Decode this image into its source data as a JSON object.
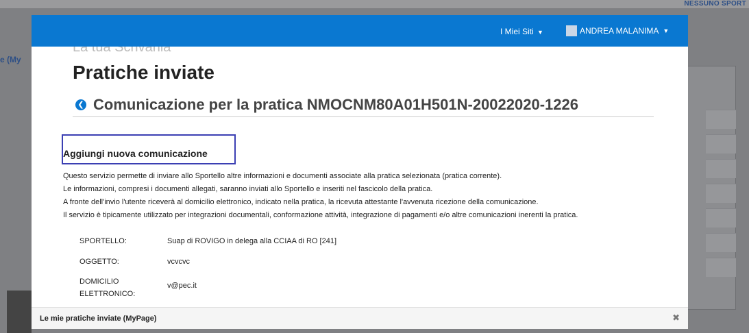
{
  "background": {
    "top_right_text": "NESSUNO SPORT",
    "left_text": "e (My"
  },
  "topbar": {
    "sites_label": "I Miei Siti",
    "user_name": "ANDREA MALANIMA"
  },
  "page": {
    "ghost_title": "La tua Scrivania",
    "title": "Pratiche inviate",
    "subtitle": "Comunicazione per la pratica NMOCNM80A01H501N-20022020-1226"
  },
  "section": {
    "title": "Aggiungi nuova comunicazione",
    "description": [
      "Questo servizio permette di inviare allo Sportello altre informazioni e documenti associate alla pratica selezionata (pratica corrente).",
      "Le informazioni, compresi i documenti allegati, saranno inviati allo Sportello e inseriti nel fascicolo della pratica.",
      "A fronte dell'invio l'utente riceverà al domicilio elettronico, indicato nella pratica, la ricevuta attestante l'avvenuta ricezione della comunicazione.",
      "Il servizio è tipicamente utilizzato per integrazioni documentali, conformazione attività, integrazione di pagamenti e/o altre comunicazioni inerenti la pratica."
    ]
  },
  "info": [
    {
      "label": "SPORTELLO:",
      "value": "Suap di ROVIGO in delega alla CCIAA di RO [241]"
    },
    {
      "label": "OGGETTO:",
      "value": "vcvcvc"
    },
    {
      "label": "DOMICILIO ELETTRONICO:",
      "value": "v@pec.it"
    }
  ],
  "footer": {
    "label": "Le mie pratiche inviate (MyPage)",
    "close_icon": "close-icon"
  },
  "colors": {
    "topbar": "#0a78d1",
    "highlight_border": "#3b3fb3"
  }
}
